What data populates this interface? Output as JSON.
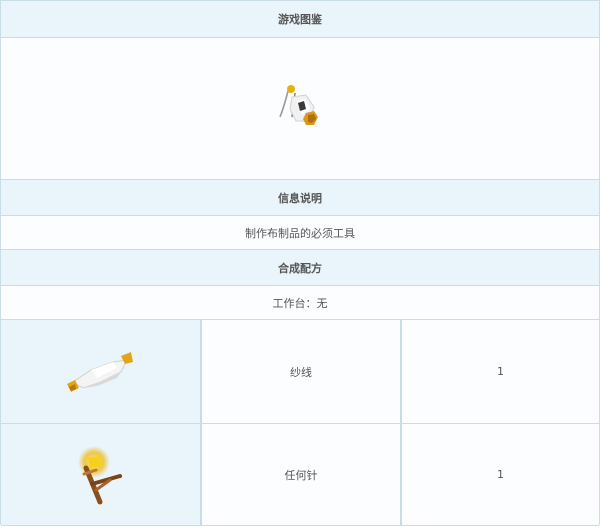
{
  "sections": {
    "gallery_header": "游戏图鉴",
    "info_header": "信息说明",
    "info_text": "制作布制品的必须工具",
    "recipe_header": "合成配方",
    "workbench_text": "工作台：无"
  },
  "gallery": {
    "icon": "sewing-tool-icon"
  },
  "recipe": {
    "ingredients": [
      {
        "icon": "yarn-spool-icon",
        "name": "纱线",
        "qty": "1"
      },
      {
        "icon": "any-needle-icon",
        "name": "任何针",
        "qty": "1"
      }
    ]
  }
}
